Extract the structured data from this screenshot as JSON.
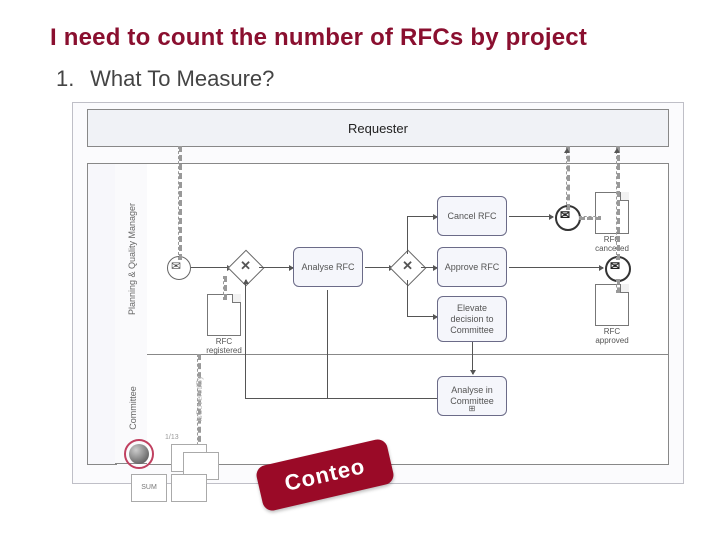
{
  "title": "I need to count the number of RFCs by project",
  "section_number": "1.",
  "section_text": "What To Measure?",
  "pool_top": "Requester",
  "lane_pool": "",
  "lane1": "Planning & Quality Manager",
  "lane2": "Committee",
  "tasks": {
    "analyse": "Analyse RFC",
    "cancel": "Cancel RFC",
    "approve": "Approve RFC",
    "elevate": "Elevate decision to Committee",
    "analyse_committee": "Analyse in Committee"
  },
  "docs": {
    "registered": "RFC registered",
    "cancelled": "RFC cancelled",
    "approved": "RFC approved"
  },
  "tools": {
    "sum": "SUM",
    "top_label": "1/13"
  },
  "callout": "Conteo",
  "colors": {
    "accent": "#8a0f2f",
    "callout_bg": "#9a0a27"
  }
}
